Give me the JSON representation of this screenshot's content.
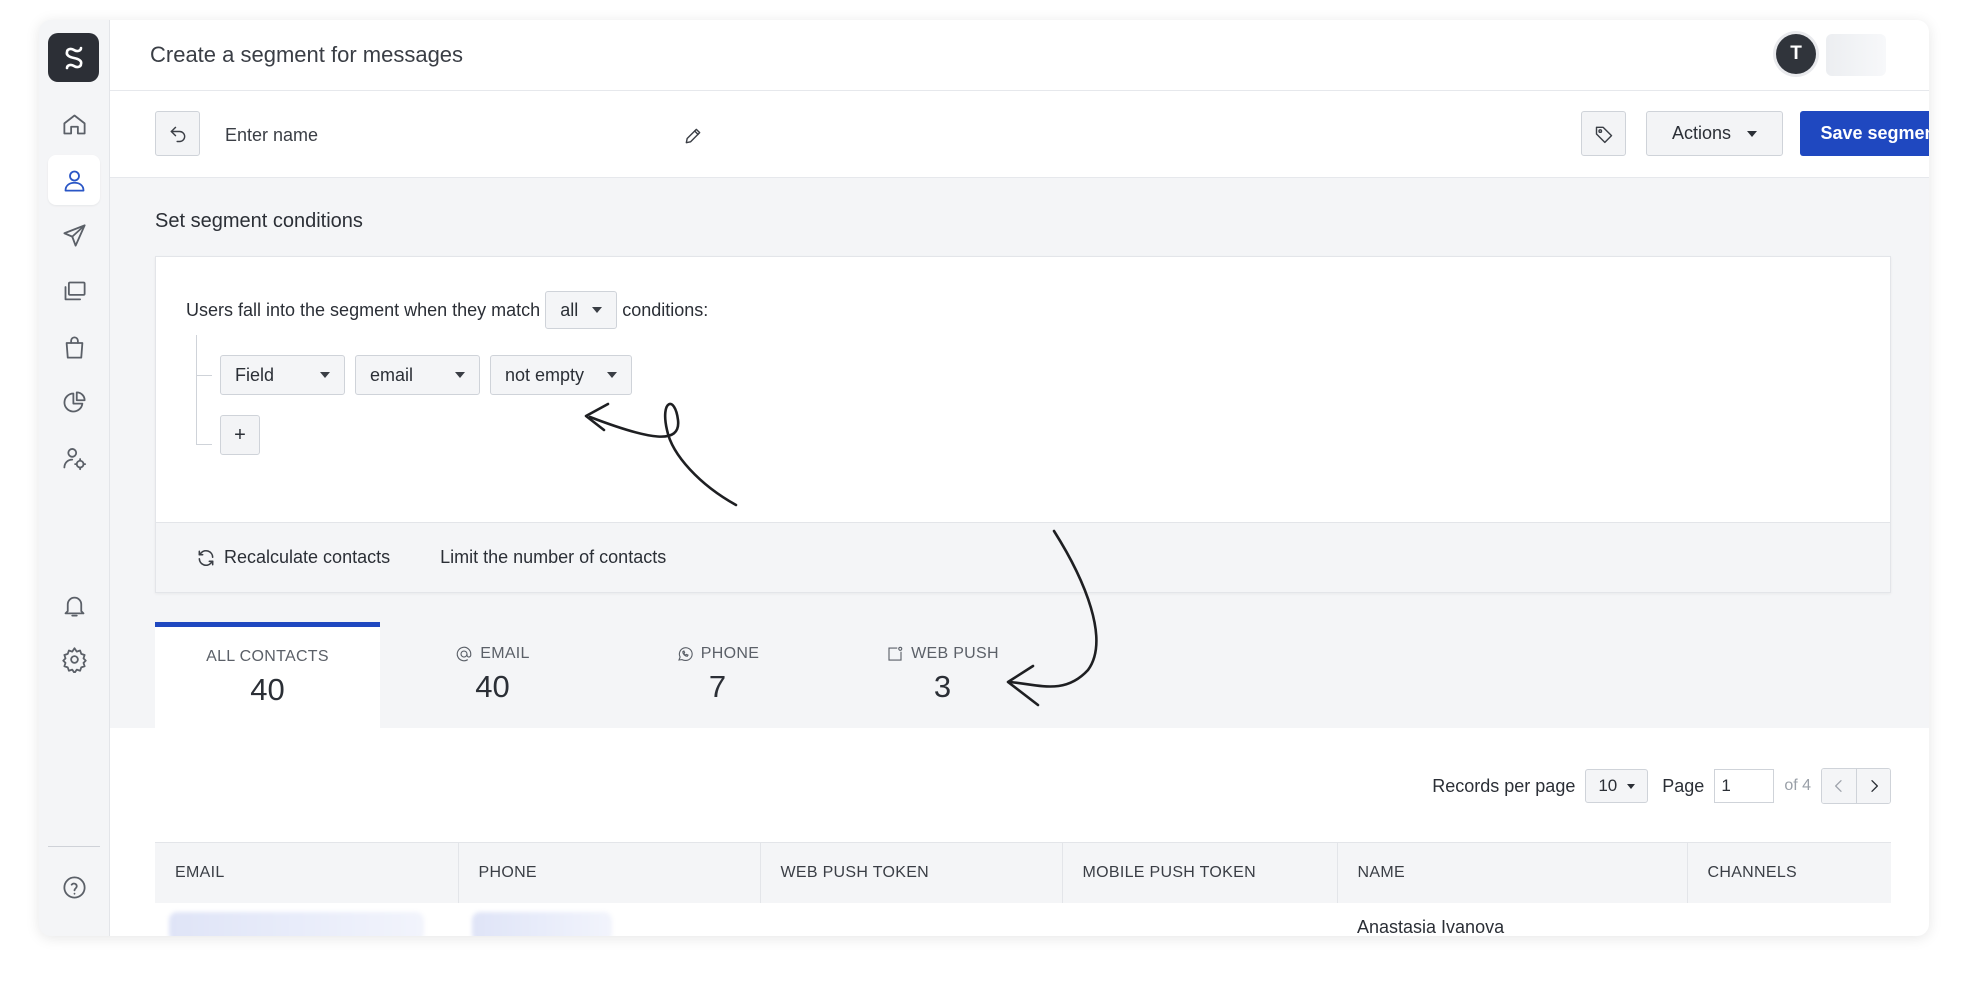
{
  "header": {
    "title": "Create a segment for messages",
    "avatar_initial": "T"
  },
  "sidebar": {
    "items": [
      {
        "icon": "home-icon"
      },
      {
        "icon": "contacts-icon",
        "active": true
      },
      {
        "icon": "send-icon"
      },
      {
        "icon": "templates-icon"
      },
      {
        "icon": "shopping-bag-icon"
      },
      {
        "icon": "analytics-icon"
      },
      {
        "icon": "user-settings-icon"
      },
      {
        "icon": "bell-icon"
      },
      {
        "icon": "gear-icon"
      },
      {
        "icon": "help-icon"
      }
    ]
  },
  "toolbar": {
    "name_placeholder": "Enter name",
    "actions_label": "Actions",
    "save_label": "Save segment"
  },
  "conditions": {
    "section_title": "Set segment conditions",
    "match_prefix": "Users fall into the segment when they match",
    "match_value": "all",
    "match_suffix": "conditions:",
    "rule": {
      "type": "Field",
      "field": "email",
      "operator": "not empty"
    },
    "add_label": "+",
    "recalculate_label": "Recalculate contacts",
    "limit_label": "Limit the number of contacts"
  },
  "tabs": [
    {
      "label": "ALL CONTACTS",
      "count": "40"
    },
    {
      "label": "EMAIL",
      "count": "40"
    },
    {
      "label": "PHONE",
      "count": "7"
    },
    {
      "label": "WEB PUSH",
      "count": "3"
    }
  ],
  "pager": {
    "records_label": "Records per page",
    "records_value": "10",
    "page_label": "Page",
    "page_value": "1",
    "of_label": "of 4"
  },
  "table": {
    "columns": [
      "EMAIL",
      "PHONE",
      "WEB PUSH TOKEN",
      "MOBILE PUSH TOKEN",
      "NAME",
      "CHANNELS"
    ],
    "rows": [
      {
        "name": "Anastasia Ivanova"
      }
    ]
  },
  "colors": {
    "primary": "#1f48c0",
    "active_icon": "#2a56c6"
  }
}
